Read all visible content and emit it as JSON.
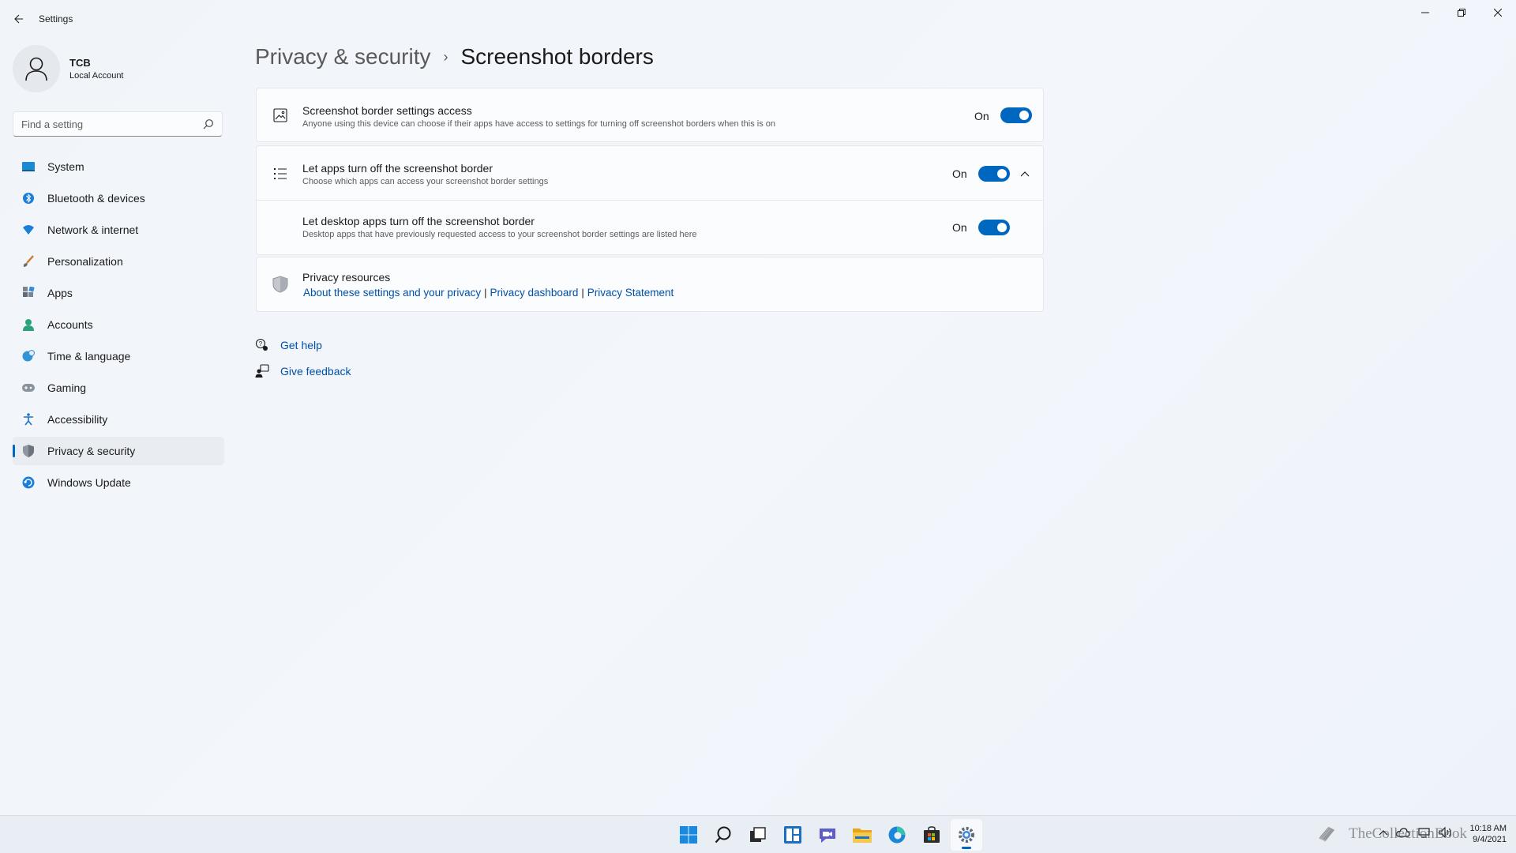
{
  "window": {
    "title": "Settings",
    "controls": {
      "minimize": "minimize-icon",
      "maximize": "restore-icon",
      "close": "close-icon"
    }
  },
  "user": {
    "name": "TCB",
    "account_type": "Local Account"
  },
  "search": {
    "placeholder": "Find a setting"
  },
  "sidebar": {
    "items": [
      {
        "label": "System",
        "icon": "system-icon",
        "active": false
      },
      {
        "label": "Bluetooth & devices",
        "icon": "bluetooth-icon",
        "active": false
      },
      {
        "label": "Network & internet",
        "icon": "network-icon",
        "active": false
      },
      {
        "label": "Personalization",
        "icon": "brush-icon",
        "active": false
      },
      {
        "label": "Apps",
        "icon": "apps-icon",
        "active": false
      },
      {
        "label": "Accounts",
        "icon": "accounts-icon",
        "active": false
      },
      {
        "label": "Time & language",
        "icon": "globe-clock-icon",
        "active": false
      },
      {
        "label": "Gaming",
        "icon": "gamepad-icon",
        "active": false
      },
      {
        "label": "Accessibility",
        "icon": "accessibility-icon",
        "active": false
      },
      {
        "label": "Privacy & security",
        "icon": "shield-icon",
        "active": true
      },
      {
        "label": "Windows Update",
        "icon": "update-icon",
        "active": false
      }
    ]
  },
  "breadcrumb": {
    "parent": "Privacy & security",
    "separator": "›",
    "current": "Screenshot borders"
  },
  "settings": [
    {
      "title": "Screenshot border settings access",
      "description": "Anyone using this device can choose if their apps have access to settings for turning off screenshot borders when this is on",
      "state": "On",
      "enabled": true
    },
    {
      "title": "Let apps turn off the screenshot border",
      "description": "Choose which apps can access your screenshot border settings",
      "state": "On",
      "enabled": true,
      "expanded": true
    },
    {
      "title": "Let desktop apps turn off the screenshot border",
      "description": "Desktop apps that have previously requested access to your screenshot border settings are listed here",
      "state": "On",
      "enabled": true
    }
  ],
  "privacy_resources": {
    "title": "Privacy resources",
    "links": [
      "About these settings and your privacy",
      "Privacy dashboard",
      "Privacy Statement"
    ]
  },
  "help": {
    "get_help": "Get help",
    "give_feedback": "Give feedback"
  },
  "taskbar": {
    "apps": [
      "start-icon",
      "search-icon",
      "task-view-icon",
      "widgets-icon",
      "chat-icon",
      "file-explorer-icon",
      "edge-icon",
      "store-icon",
      "settings-icon"
    ],
    "active_app": "settings-icon",
    "time": "10:18 AM",
    "date": "9/4/2021"
  },
  "watermark": {
    "text": "TheCollectionBook"
  },
  "colors": {
    "accent": "#0067c0",
    "link": "#0050a8",
    "background": "#f3f6fb",
    "card": "#fbfcfd"
  }
}
